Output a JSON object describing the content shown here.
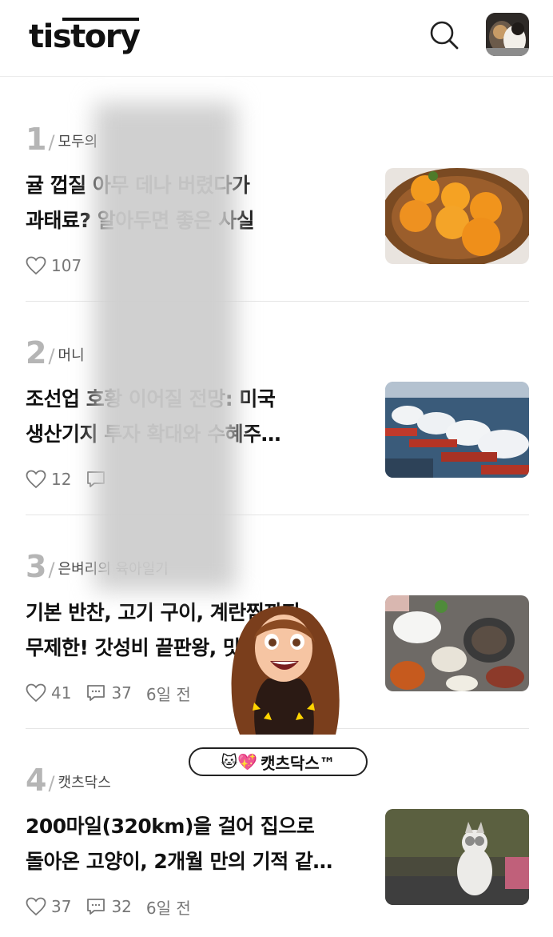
{
  "header": {
    "logo": "tistory",
    "search_icon": "search-icon",
    "avatar_icon": "cat-avatar"
  },
  "articles": [
    {
      "rank": "1",
      "blog": "모두의",
      "title_line1": "귤 껍질 아무 데나 버렸다가",
      "title_line2": "과태료? 알아두면 좋은 사실",
      "likes": "107",
      "comments": "",
      "time": "",
      "thumb": "tangerines-photo"
    },
    {
      "rank": "2",
      "blog": "머니",
      "title_line1": "조선업 호황 이어질 전망: 미국",
      "title_line2": "생산기지 투자 확대와 수혜주…",
      "likes": "12",
      "comments": "",
      "time": "",
      "thumb": "lng-ships-photo"
    },
    {
      "rank": "3",
      "blog": "은벼리의 육아일기",
      "title_line1": "기본 반찬, 고기 구이, 계란찜까지",
      "title_line2": "무제한! 갓성비 끝판왕, 맛집…",
      "likes": "41",
      "comments": "37",
      "time": "6일 전",
      "thumb": "korean-bbq-photo"
    },
    {
      "rank": "4",
      "blog": "캣츠닥스",
      "title_line1": "200마일(320km)을 걸어 집으로",
      "title_line2": "돌아온 고양이, 2개월 만의 기적 같…",
      "likes": "37",
      "comments": "32",
      "time": "6일 전",
      "thumb": "cat-photo"
    }
  ],
  "promo": {
    "badge_emoji": "🐱💖",
    "badge_text": "캣츠닥스™"
  },
  "colors": {
    "rank": "#b5b5b5",
    "meta": "#777777",
    "divider": "#e6e6e6"
  }
}
